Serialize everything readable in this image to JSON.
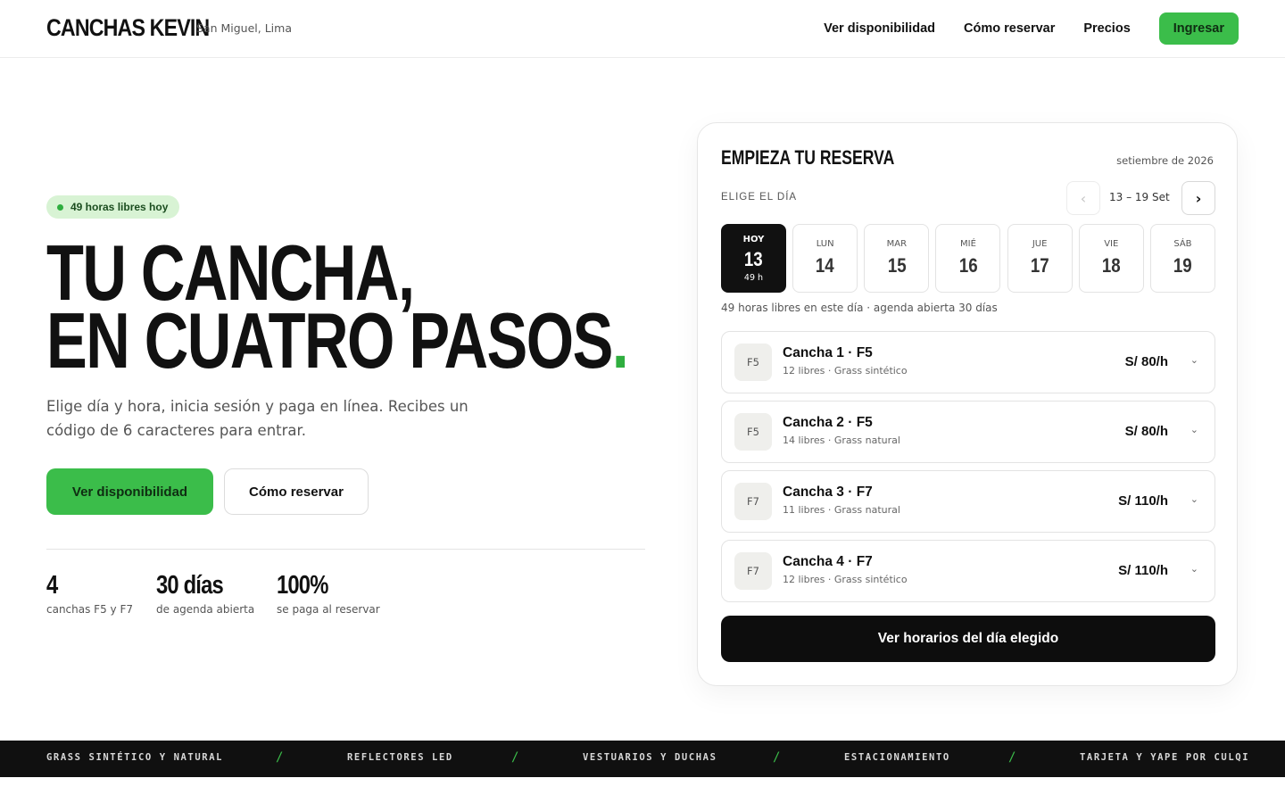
{
  "header": {
    "brand": "CANCHAS KEVIN",
    "location": "San Miguel, Lima",
    "nav": [
      "Ver disponibilidad",
      "Cómo reservar",
      "Precios"
    ],
    "login_label": "Ingresar"
  },
  "hero": {
    "badge": "49 horas libres hoy",
    "title_line1": "TU CANCHA,",
    "title_line2": "EN CUATRO PASOS",
    "title_dot": ".",
    "subtitle": "Elige día y hora, inicia sesión y paga en línea. Recibes un código de 6 caracteres para entrar.",
    "primary_cta": "Ver disponibilidad",
    "secondary_cta": "Cómo reservar",
    "stats": [
      {
        "value": "4",
        "label": "canchas F5 y F7"
      },
      {
        "value": "30 días",
        "label": "de agenda abierta"
      },
      {
        "value": "100%",
        "label": "se paga al reservar"
      }
    ]
  },
  "booking": {
    "title": "EMPIEZA TU RESERVA",
    "month": "setiembre de 2026",
    "day_label": "ELIGE EL DÍA",
    "week_range": "13 – 19 Set",
    "prev_glyph": "‹",
    "next_glyph": "›",
    "days": [
      {
        "name": "HOY",
        "num": "13",
        "hours": "49 h"
      },
      {
        "name": "LUN",
        "num": "14"
      },
      {
        "name": "MAR",
        "num": "15"
      },
      {
        "name": "MIÉ",
        "num": "16"
      },
      {
        "name": "JUE",
        "num": "17"
      },
      {
        "name": "VIE",
        "num": "18"
      },
      {
        "name": "SÁB",
        "num": "19"
      }
    ],
    "day_info": "49 horas libres en este día · agenda abierta 30 días",
    "courts": [
      {
        "badge": "F5",
        "name": "Cancha 1 · F5",
        "meta": "12 libres · Grass sintético",
        "price": "S/ 80/h"
      },
      {
        "badge": "F5",
        "name": "Cancha 2 · F5",
        "meta": "14 libres · Grass natural",
        "price": "S/ 80/h"
      },
      {
        "badge": "F7",
        "name": "Cancha 3 · F7",
        "meta": "11 libres · Grass natural",
        "price": "S/ 110/h"
      },
      {
        "badge": "F7",
        "name": "Cancha 4 · F7",
        "meta": "12 libres · Grass sintético",
        "price": "S/ 110/h"
      }
    ],
    "chevron_glyph": "⌄",
    "cta": "Ver horarios del día elegido"
  },
  "features": {
    "items": [
      "GRASS SINTÉTICO Y NATURAL",
      "REFLECTORES LED",
      "VESTUARIOS Y DUCHAS",
      "ESTACIONAMIENTO",
      "TARJETA Y YAPE POR CULQI"
    ],
    "separator": "/"
  },
  "colors": {
    "accent": "#3bbd4a",
    "accent_dark": "#2fae3f",
    "badge_bg": "#d8f3d4",
    "dark": "#101010"
  }
}
